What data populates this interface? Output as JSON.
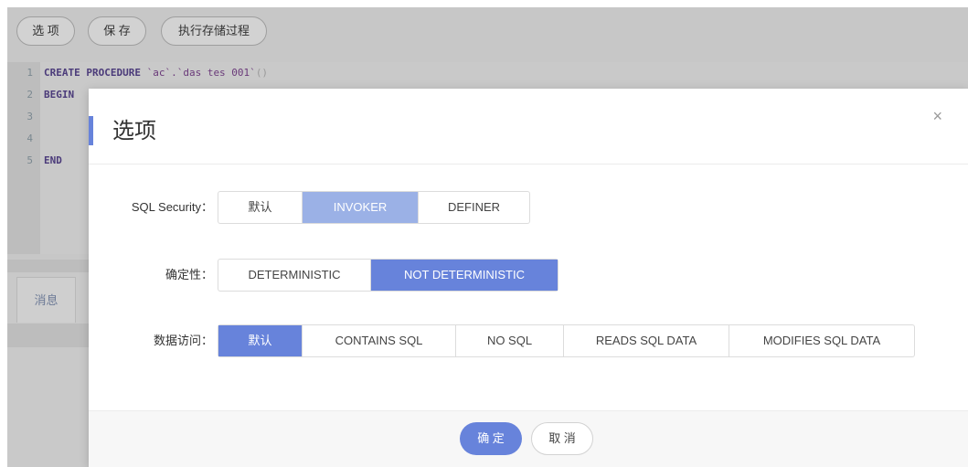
{
  "toolbar": {
    "options_label": "选 项",
    "save_label": "保 存",
    "exec_label": "执行存储过程"
  },
  "editor": {
    "lines": [
      {
        "num": "1",
        "kw": "CREATE PROCEDURE",
        "rest": " `ac`.`das tes 001`",
        "paren": "()"
      },
      {
        "num": "2",
        "kw": "BEGIN",
        "rest": "",
        "paren": ""
      },
      {
        "num": "3",
        "kw": "",
        "rest": "",
        "paren": ""
      },
      {
        "num": "4",
        "kw": "",
        "rest": "",
        "paren": ""
      },
      {
        "num": "5",
        "kw": "END",
        "rest": "",
        "paren": ""
      }
    ]
  },
  "messages": {
    "tab_label": "消息"
  },
  "modal": {
    "title": "选项",
    "close_glyph": "×",
    "sql_security": {
      "label": "SQL Security：",
      "options": [
        "默认",
        "INVOKER",
        "DEFINER"
      ],
      "selected": "INVOKER"
    },
    "deterministic": {
      "label": "确定性：",
      "options": [
        "DETERMINISTIC",
        "NOT DETERMINISTIC"
      ],
      "selected": "NOT DETERMINISTIC"
    },
    "data_access": {
      "label": "数据访问：",
      "options": [
        "默认",
        "CONTAINS SQL",
        "NO SQL",
        "READS SQL DATA",
        "MODIFIES SQL DATA"
      ],
      "selected": "默认"
    },
    "ok_label": "确 定",
    "cancel_label": "取 消"
  },
  "colors": {
    "accent": "#6783db",
    "accent_light": "#9bb1e6",
    "overlay_bg": "#c7c7c7"
  }
}
